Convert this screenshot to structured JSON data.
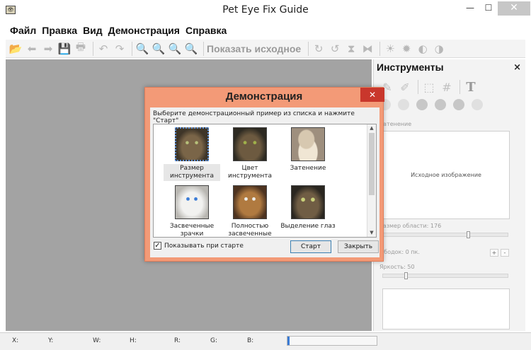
{
  "app": {
    "title": "Pet Eye Fix Guide",
    "icon_text": "👁",
    "min_label": "—",
    "max_label": "☐",
    "close_label": "✕"
  },
  "menu": [
    "Файл",
    "Правка",
    "Вид",
    "Демонстрация",
    "Справка"
  ],
  "toolbar": {
    "show_original_label": "Показать исходное"
  },
  "panel": {
    "title": "Инструменты",
    "close_label": "×",
    "text_tool": "T",
    "shading_label": "Затенение",
    "source_image_label": "Исходное изображение",
    "area_size_label": "Размер области: 176",
    "area_size_value": 176,
    "border_label": "Ободок: 0 пк.",
    "brightness_label": "Яркость: 50",
    "brightness_value": 50,
    "plus_label": "+",
    "minus_label": "-"
  },
  "statusbar": {
    "x": "X:",
    "y": "Y:",
    "w": "W:",
    "h": "H:",
    "r": "R:",
    "g": "G:",
    "b": "B:",
    "progress": 0.02
  },
  "dialog": {
    "title": "Демонстрация",
    "close_label": "✕",
    "instruction": "Выберите демонстрационный пример из списка и нажмите \"Старт\"",
    "items": [
      {
        "line1": "Размер",
        "line2": "инструмента",
        "thumb": "t-tabby",
        "selected": true
      },
      {
        "line1": "Цвет инструмента",
        "line2": "",
        "thumb": "t-tabby2",
        "selected": false
      },
      {
        "line1": "Затенение",
        "line2": "",
        "thumb": "t-sleep",
        "selected": false
      },
      {
        "line1": "Засвеченные",
        "line2": "зрачки",
        "thumb": "t-white",
        "selected": false
      },
      {
        "line1": "Полностью",
        "line2": "засвеченные глаза",
        "thumb": "t-dog",
        "selected": false
      },
      {
        "line1": "Выделение глаз",
        "line2": "",
        "thumb": "t-eyes",
        "selected": false
      }
    ],
    "show_on_start_label": "Показывать при старте",
    "show_on_start_checked": true,
    "start_button": "Старт",
    "close_button": "Закрыть"
  },
  "colors": {
    "dialog_frame": "#f39a77",
    "dialog_close": "#c9372c",
    "canvas": "#a3a3a3"
  }
}
